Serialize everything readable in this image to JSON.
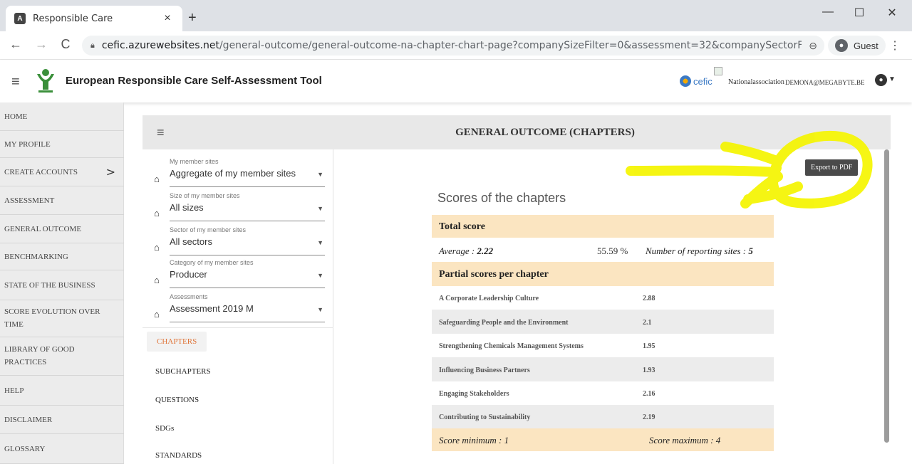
{
  "browser": {
    "tab_title": "Responsible Care",
    "tab_close": "×",
    "new_tab": "+",
    "url_host": "cefic.azurewebsites.net",
    "url_path": "/general-outcome/general-outcome-na-chapter-chart-page?companySizeFilter=0&assessment=32&companySectorFilter=0&compa...",
    "profile_label": "Guest",
    "minimize": "—",
    "maximize": "☐",
    "close": "✕",
    "back": "←",
    "forward": "→",
    "reload": "C",
    "zoom": "⊖",
    "menu": "⋮"
  },
  "header": {
    "title": "European Responsible Care Self-Assessment Tool",
    "cefic_label": "cefic",
    "national_association": "Nationalassociation",
    "user_email": "DEMONA@MEGABYTE.BE"
  },
  "sidebar": {
    "items": [
      {
        "label": "HOME"
      },
      {
        "label": "MY PROFILE"
      },
      {
        "label": "CREATE ACCOUNTS"
      },
      {
        "label": "ASSESSMENT"
      },
      {
        "label": "GENERAL OUTCOME"
      },
      {
        "label": "BENCHMARKING"
      },
      {
        "label": "STATE OF THE BUSINESS"
      },
      {
        "label": "SCORE EVOLUTION OVER TIME"
      },
      {
        "label": "LIBRARY OF GOOD PRACTICES"
      },
      {
        "label": "HELP"
      },
      {
        "label": "DISCLAIMER"
      },
      {
        "label": "GLOSSARY"
      }
    ]
  },
  "panel": {
    "title": "GENERAL OUTCOME (CHAPTERS)",
    "filters": [
      {
        "label": "My member sites",
        "value": "Aggregate of my member sites"
      },
      {
        "label": "Size of my member sites",
        "value": "All sizes"
      },
      {
        "label": "Sector of my member sites",
        "value": "All sectors"
      },
      {
        "label": "Category of my member sites",
        "value": "Producer"
      },
      {
        "label": "Assessments",
        "value": "Assessment 2019 M"
      }
    ],
    "subnav": [
      "CHAPTERS",
      "SUBCHAPTERS",
      "QUESTIONS",
      "SDGs",
      "STANDARDS"
    ],
    "export_label": "Export to PDF",
    "scores_title": "Scores of the chapters",
    "total_score_label": "Total score",
    "average_label": "Average : ",
    "average_value": "2.22",
    "percent": "55.59 %",
    "reporting_label": "Number of reporting sites : ",
    "reporting_value": "5",
    "partial_label": "Partial scores per chapter",
    "chapters": [
      {
        "name": "A Corporate Leadership Culture",
        "score": "2.88"
      },
      {
        "name": "Safeguarding People and the Environment",
        "score": "2.1"
      },
      {
        "name": "Strengthening Chemicals Management Systems",
        "score": "1.95"
      },
      {
        "name": "Influencing Business Partners",
        "score": "1.93"
      },
      {
        "name": "Engaging Stakeholders",
        "score": "2.16"
      },
      {
        "name": "Contributing to Sustainability",
        "score": "2.19"
      }
    ],
    "score_min": "Score minimum : 1",
    "score_max": "Score maximum : 4"
  },
  "colors": {
    "band": "#fbe5c1",
    "active_subnav": "#e0763b",
    "annotation": "#f5f500"
  }
}
